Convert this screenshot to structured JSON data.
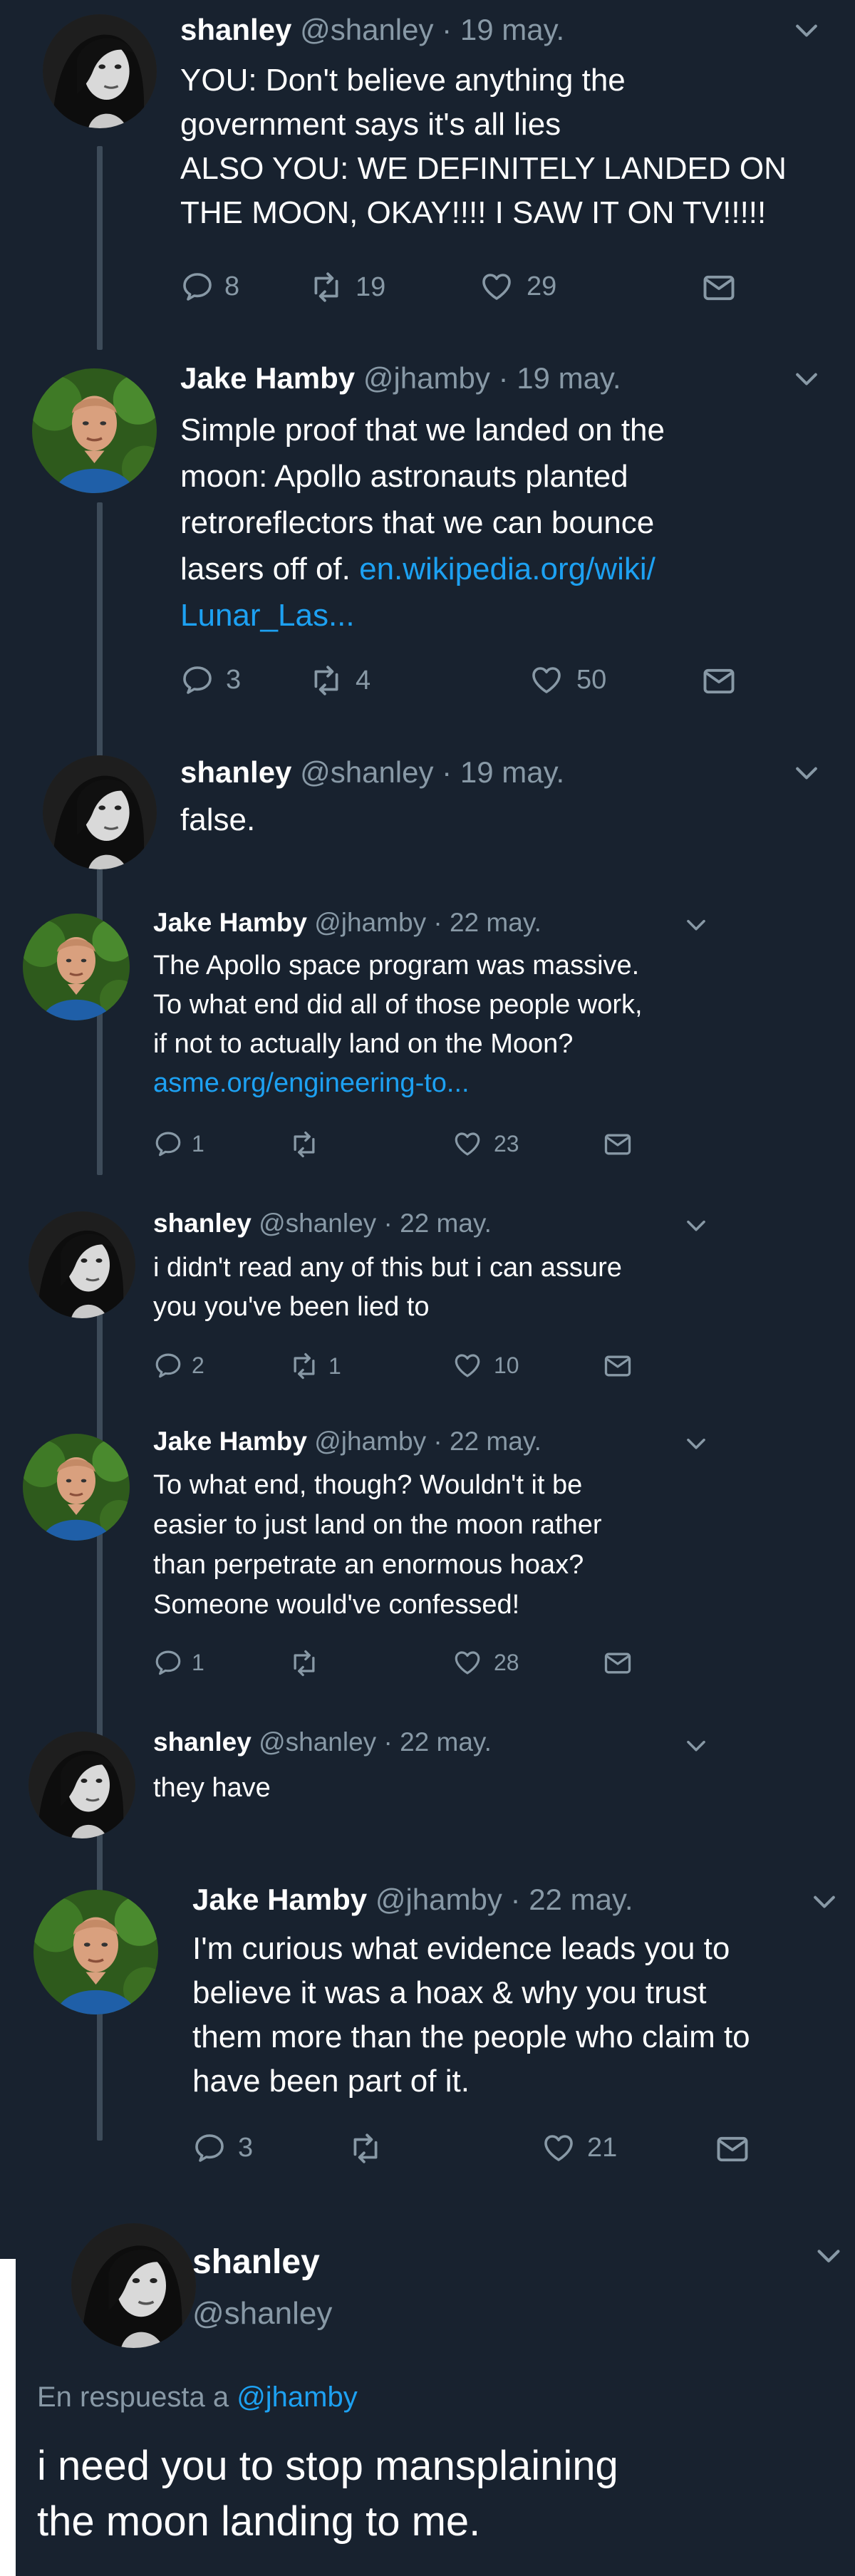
{
  "tweets": [
    {
      "name": "shanley",
      "handle": "@shanley",
      "date": "19 may.",
      "lines": [
        "YOU: Don't believe anything the",
        "government says it's all lies",
        "ALSO YOU: WE DEFINITELY LANDED ON",
        "THE MOON, OKAY!!!! I SAW IT ON TV!!!!!"
      ],
      "replies": "8",
      "retweets": "19",
      "likes": "29"
    },
    {
      "name": "Jake Hamby",
      "handle": "@jhamby",
      "date": "19 may.",
      "lines": [
        "Simple proof that we landed on the",
        "moon: Apollo astronauts planted",
        "retroreflectors that we can bounce"
      ],
      "line4_text": "lasers off of. ",
      "link1": "en.wikipedia.org/wiki/",
      "link2": "Lunar_Las...",
      "replies": "3",
      "retweets": "4",
      "likes": "50"
    },
    {
      "name": "shanley",
      "handle": "@shanley",
      "date": "19 may.",
      "lines": [
        "false."
      ]
    },
    {
      "name": "Jake Hamby",
      "handle": "@jhamby",
      "date": "22 may.",
      "lines": [
        "The Apollo space program was massive.",
        "To what end did all of those people work,",
        "if not to actually land on the Moon?"
      ],
      "link": "asme.org/engineering-to...",
      "replies": "1",
      "retweets": "",
      "likes": "23"
    },
    {
      "name": "shanley",
      "handle": "@shanley",
      "date": "22 may.",
      "lines": [
        "i didn't read any of this but i can assure",
        "you you've been lied to"
      ],
      "replies": "2",
      "retweets": "1",
      "likes": "10"
    },
    {
      "name": "Jake Hamby",
      "handle": "@jhamby",
      "date": "22 may.",
      "lines": [
        "To what end, though? Wouldn't it be",
        "easier to just land on the moon rather",
        "than perpetrate an enormous hoax?",
        "Someone would've confessed!"
      ],
      "replies": "1",
      "retweets": "",
      "likes": "28"
    },
    {
      "name": "shanley",
      "handle": "@shanley",
      "date": "22 may.",
      "lines": [
        "they have"
      ]
    },
    {
      "name": "Jake Hamby",
      "handle": "@jhamby",
      "date": "22 may.",
      "lines": [
        "I'm curious what evidence leads you to",
        "believe it was a hoax & why you trust",
        "them more than the people who claim to",
        "have been part of it."
      ],
      "replies": "3",
      "retweets": "",
      "likes": "21"
    }
  ],
  "final": {
    "name": "shanley",
    "handle": "@shanley",
    "reply_to_prefix": "En respuesta a ",
    "reply_to_handle": "@jhamby",
    "lines": [
      "i need you to stop mansplaining",
      "the moon landing to me."
    ]
  },
  "icons": [
    "reply-icon",
    "retweet-icon",
    "like-icon",
    "message-icon",
    "chevron-down-icon"
  ],
  "colors": {
    "background": "#18222f",
    "text": "#ffffff",
    "secondary": "#8899a6",
    "link": "#1da1f2",
    "thread": "#3d4b59"
  }
}
